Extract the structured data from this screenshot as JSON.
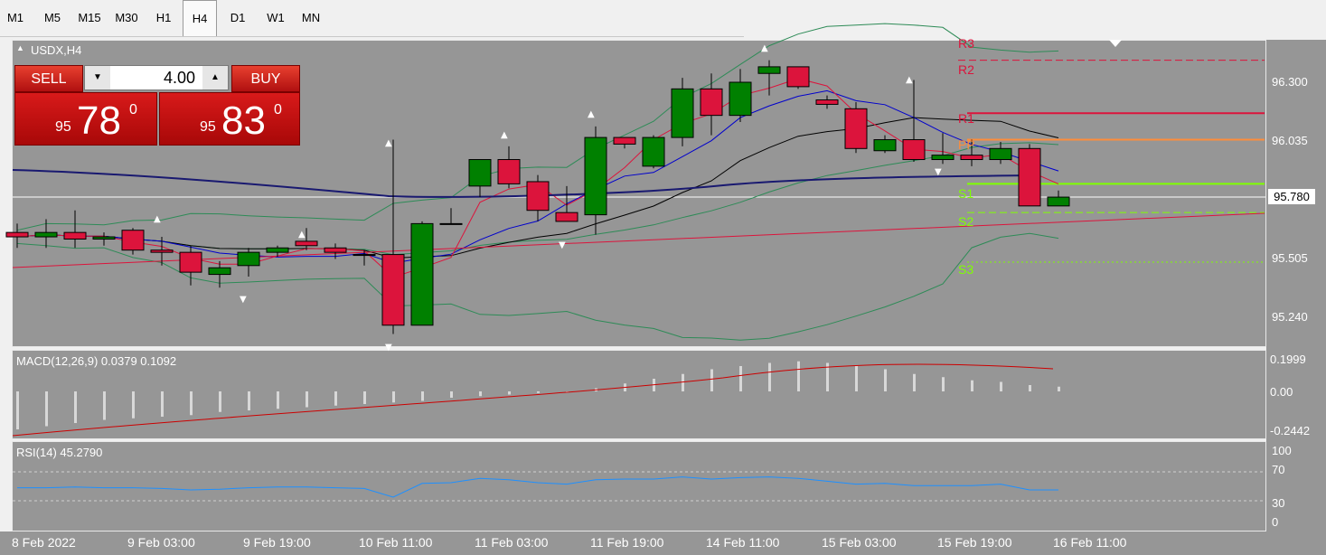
{
  "timeframes": [
    "M1",
    "M5",
    "M15",
    "M30",
    "H1",
    "H4",
    "D1",
    "W1",
    "MN"
  ],
  "active_timeframe": "H4",
  "chart": {
    "symbol_label": "USDX,H4"
  },
  "trade_panel": {
    "sell_label": "SELL",
    "buy_label": "BUY",
    "lot_value": "4.00",
    "sell_price": {
      "prefix": "95",
      "big": "78",
      "sup": "0"
    },
    "buy_price": {
      "prefix": "95",
      "big": "83",
      "sup": "0"
    }
  },
  "price_axis": {
    "labels": [
      "96.300",
      "96.035",
      "95.780",
      "95.505",
      "95.240"
    ],
    "current_price": "95.780"
  },
  "pivot_labels": {
    "r3": "R3",
    "r2": "R2",
    "r1": "R1",
    "pp": "PP",
    "s1": "S1",
    "s2": "S2",
    "s3": "S3"
  },
  "macd": {
    "title": "MACD(12,26,9) 0.0379 0.1092",
    "axis_labels": [
      "0.1999",
      "0.00",
      "-0.2442"
    ]
  },
  "rsi": {
    "title": "RSI(14) 45.2790",
    "axis_labels": [
      "100",
      "70",
      "30",
      "0"
    ]
  },
  "time_axis": {
    "labels": [
      "8 Feb 2022",
      "9 Feb 03:00",
      "9 Feb 19:00",
      "10 Feb 11:00",
      "11 Feb 03:00",
      "11 Feb 19:00",
      "14 Feb 11:00",
      "15 Feb 03:00",
      "15 Feb 19:00",
      "16 Feb 11:00"
    ]
  },
  "colors": {
    "bull": "#008000",
    "bear": "#dc143c",
    "background": "#969696",
    "accent_blue": "#0000cd",
    "pivot_r": "#dc143c",
    "pivot_s": "#7fff00"
  },
  "chart_data": {
    "type": "candlestick",
    "title": "USDX,H4",
    "ylim": [
      95.12,
      96.45
    ],
    "candles": [
      [
        95.62,
        95.66,
        95.55,
        95.6
      ],
      [
        95.6,
        95.68,
        95.55,
        95.62
      ],
      [
        95.62,
        95.72,
        95.55,
        95.59
      ],
      [
        95.59,
        95.62,
        95.56,
        95.6
      ],
      [
        95.63,
        95.64,
        95.52,
        95.54
      ],
      [
        95.54,
        95.6,
        95.47,
        95.53
      ],
      [
        95.53,
        95.56,
        95.38,
        95.44
      ],
      [
        95.43,
        95.49,
        95.37,
        95.46
      ],
      [
        95.47,
        95.55,
        95.42,
        95.53
      ],
      [
        95.53,
        95.56,
        95.51,
        95.55
      ],
      [
        95.58,
        95.64,
        95.54,
        95.56
      ],
      [
        95.55,
        95.57,
        95.5,
        95.53
      ],
      [
        95.52,
        95.54,
        95.47,
        95.52
      ],
      [
        95.52,
        96.04,
        95.16,
        95.2
      ],
      [
        95.2,
        95.67,
        95.2,
        95.66
      ],
      [
        95.66,
        95.73,
        95.66,
        95.66
      ],
      [
        95.83,
        95.89,
        95.78,
        95.95
      ],
      [
        95.95,
        96.01,
        95.82,
        95.84
      ],
      [
        95.85,
        95.88,
        95.67,
        95.72
      ],
      [
        95.71,
        95.83,
        95.68,
        95.67
      ],
      [
        95.7,
        96.1,
        95.61,
        96.05
      ],
      [
        96.05,
        96.05,
        96.0,
        96.02
      ],
      [
        95.92,
        96.06,
        95.91,
        96.05
      ],
      [
        96.05,
        96.32,
        96.01,
        96.27
      ],
      [
        96.27,
        96.34,
        96.06,
        96.15
      ],
      [
        96.15,
        96.36,
        96.12,
        96.3
      ],
      [
        96.34,
        96.4,
        96.24,
        96.37
      ],
      [
        96.37,
        96.37,
        96.27,
        96.28
      ],
      [
        96.22,
        96.24,
        96.18,
        96.2
      ],
      [
        96.18,
        96.21,
        95.98,
        96.0
      ],
      [
        95.99,
        96.06,
        95.98,
        96.04
      ],
      [
        96.04,
        96.31,
        95.94,
        95.95
      ],
      [
        95.95,
        96.07,
        95.93,
        95.97
      ],
      [
        95.97,
        96.04,
        95.92,
        95.95
      ],
      [
        95.95,
        96.03,
        95.93,
        96.0
      ],
      [
        96.0,
        96.02,
        95.74,
        95.74
      ],
      [
        95.74,
        95.81,
        95.74,
        95.78
      ]
    ],
    "pivots": {
      "R2": 96.4,
      "R1": 96.16,
      "PP": 96.04,
      "S1": 95.84,
      "S2": 95.71
    },
    "macd": {
      "histogram": [
        -0.24,
        -0.22,
        -0.2,
        -0.18,
        -0.17,
        -0.16,
        -0.15,
        -0.13,
        -0.12,
        -0.11,
        -0.1,
        -0.09,
        -0.08,
        -0.07,
        -0.06,
        -0.04,
        -0.03,
        -0.02,
        -0.01,
        0.0,
        0.02,
        0.05,
        0.08,
        0.11,
        0.14,
        0.16,
        0.18,
        0.19,
        0.18,
        0.16,
        0.14,
        0.11,
        0.09,
        0.07,
        0.06,
        0.04,
        0.03
      ]
    },
    "rsi": {
      "values": [
        48,
        48,
        49,
        48,
        48,
        47,
        45,
        46,
        48,
        49,
        49,
        48,
        47,
        35,
        54,
        55,
        61,
        59,
        55,
        53,
        59,
        60,
        60,
        63,
        60,
        62,
        63,
        61,
        57,
        53,
        54,
        51,
        51,
        51,
        53,
        45,
        45
      ],
      "levels": [
        70,
        30
      ]
    }
  }
}
